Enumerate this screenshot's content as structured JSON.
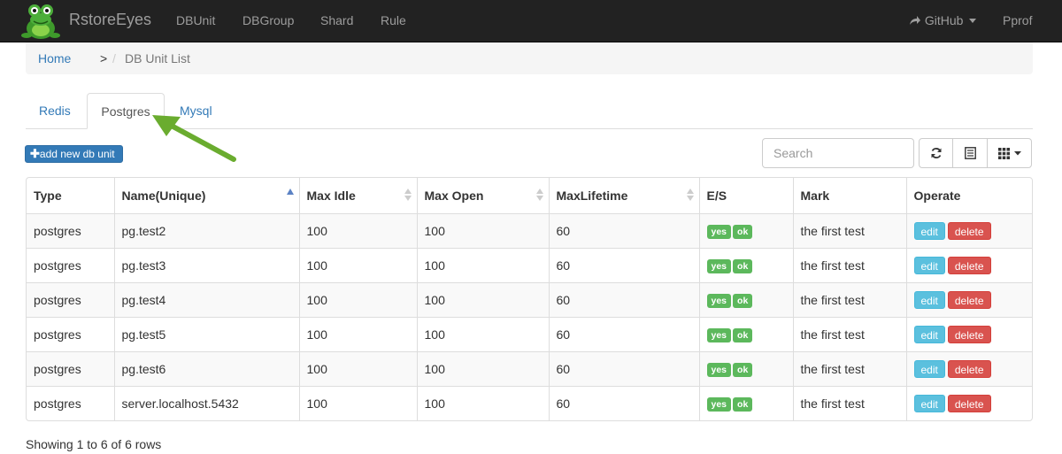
{
  "navbar": {
    "brand": "RstoreEyes",
    "links": [
      "DBUnit",
      "DBGroup",
      "Shard",
      "Rule"
    ],
    "github": "GitHub",
    "pprof": "Pprof"
  },
  "breadcrumb": {
    "home": "Home",
    "separator": ">",
    "slash": "/",
    "current": "DB Unit List"
  },
  "tabs": [
    {
      "label": "Redis",
      "active": false
    },
    {
      "label": "Postgres",
      "active": true
    },
    {
      "label": "Mysql",
      "active": false
    }
  ],
  "toolbar": {
    "add_label": "add new db unit",
    "search_placeholder": "Search"
  },
  "table": {
    "headers": [
      "Type",
      "Name(Unique)",
      "Max Idle",
      "Max Open",
      "MaxLifetime",
      "E/S",
      "Mark",
      "Operate"
    ],
    "rows": [
      {
        "type": "postgres",
        "name": "pg.test2",
        "max_idle": "100",
        "max_open": "100",
        "max_lifetime": "60",
        "e": "yes",
        "s": "ok",
        "mark": "the first test",
        "edit": "edit",
        "delete": "delete"
      },
      {
        "type": "postgres",
        "name": "pg.test3",
        "max_idle": "100",
        "max_open": "100",
        "max_lifetime": "60",
        "e": "yes",
        "s": "ok",
        "mark": "the first test",
        "edit": "edit",
        "delete": "delete"
      },
      {
        "type": "postgres",
        "name": "pg.test4",
        "max_idle": "100",
        "max_open": "100",
        "max_lifetime": "60",
        "e": "yes",
        "s": "ok",
        "mark": "the first test",
        "edit": "edit",
        "delete": "delete"
      },
      {
        "type": "postgres",
        "name": "pg.test5",
        "max_idle": "100",
        "max_open": "100",
        "max_lifetime": "60",
        "e": "yes",
        "s": "ok",
        "mark": "the first test",
        "edit": "edit",
        "delete": "delete"
      },
      {
        "type": "postgres",
        "name": "pg.test6",
        "max_idle": "100",
        "max_open": "100",
        "max_lifetime": "60",
        "e": "yes",
        "s": "ok",
        "mark": "the first test",
        "edit": "edit",
        "delete": "delete"
      },
      {
        "type": "postgres",
        "name": "server.localhost.5432",
        "max_idle": "100",
        "max_open": "100",
        "max_lifetime": "60",
        "e": "yes",
        "s": "ok",
        "mark": "the first test",
        "edit": "edit",
        "delete": "delete"
      }
    ]
  },
  "footer": {
    "pagination_info": "Showing 1 to 6 of 6 rows"
  },
  "colors": {
    "navbar_bg": "#222222",
    "primary": "#337ab7",
    "success": "#5cb85c",
    "info": "#5bc0de",
    "danger": "#d9534f",
    "arrow": "#6aac2f"
  },
  "icons": {
    "logo": "frog-logo",
    "github": "share-arrow-icon",
    "add": "plus-icon",
    "refresh": "refresh-icon",
    "columns_view": "list-icon",
    "columns_toggle": "grid-icon"
  }
}
